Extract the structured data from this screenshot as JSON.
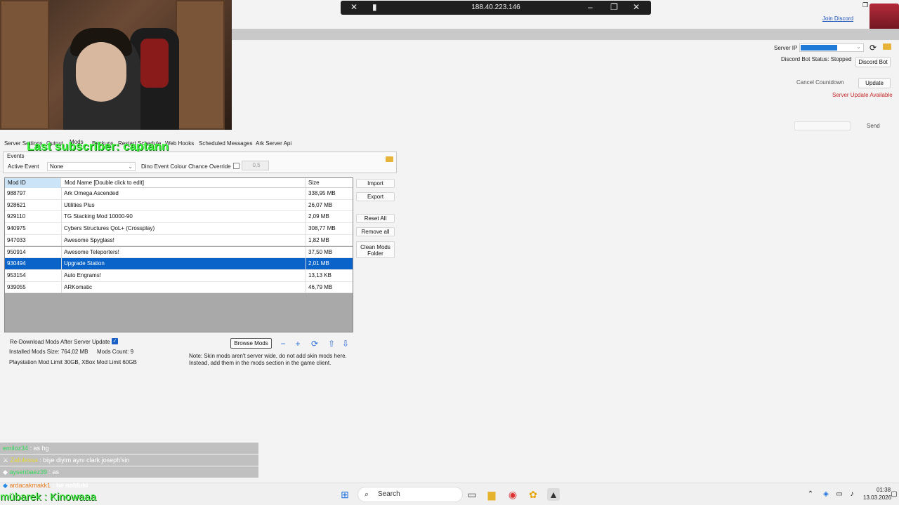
{
  "remote": {
    "ip": "188.40.223.146"
  },
  "header": {
    "join_discord": "Join Discord",
    "server_ip_label": "Server IP",
    "discord_status": "Discord Bot Status: Stopped",
    "discord_bot_button": "Discord Bot",
    "cancel_countdown": "Cancel Countdown",
    "update_button": "Update",
    "update_available": "Server Update Available",
    "send_button": "Send"
  },
  "overlay": {
    "subscriber": "Last subscriber: captann"
  },
  "tabs": [
    "Server Settings",
    "Output",
    "Mods",
    "Backups",
    "Restart Schedule",
    "Web Hooks",
    "Scheduled Messages",
    "Ark Server Api"
  ],
  "events": {
    "title": "Events",
    "active_event_label": "Active Event",
    "active_event_value": "None",
    "dino_label": "Dino Event Colour Chance Override",
    "dino_value": "0,5"
  },
  "table": {
    "headers": [
      "Mod ID",
      "Mod Name [Double click to edit]",
      "Size"
    ],
    "rows": [
      {
        "id": "988797",
        "name": "Ark Omega Ascended",
        "size": "338,95 MB"
      },
      {
        "id": "928621",
        "name": "Utilities Plus",
        "size": "26,07 MB"
      },
      {
        "id": "929110",
        "name": "TG Stacking Mod 10000-90",
        "size": "2,09 MB"
      },
      {
        "id": "940975",
        "name": "Cybers Structures QoL+ (Crossplay)",
        "size": "308,77 MB"
      },
      {
        "id": "947033",
        "name": "Awesome  Spyglass!",
        "size": "1,82 MB"
      },
      {
        "id": "950914",
        "name": "Awesome Teleporters!",
        "size": "37,50 MB"
      },
      {
        "id": "930494",
        "name": "Upgrade Station",
        "size": "2,01 MB"
      },
      {
        "id": "953154",
        "name": "Auto Engrams!",
        "size": "13,13 KB"
      },
      {
        "id": "939055",
        "name": "ARKomatic",
        "size": "46,79 MB"
      }
    ]
  },
  "side_buttons": {
    "import": "Import",
    "export": "Export",
    "reset_all": "Reset All",
    "remove_all": "Remove all",
    "clean_mods_1": "Clean Mods",
    "clean_mods_2": "Folder"
  },
  "bottom": {
    "redownload": "Re-Download Mods After Server Update",
    "installed_size": "Installed Mods Size: 764,02 MB",
    "mods_count": "Mods Count: 9",
    "limit": "Playstation Mod Limit 30GB, XBox Mod Limit 60GB",
    "browse_mods": "Browse Mods",
    "note_1": "Note: Skin mods aren't server wide, do not add skin mods here.",
    "note_2": "Instead, add them in the mods section in the game client."
  },
  "chat": [
    {
      "user": "emiloz34",
      "text": ": as hg"
    },
    {
      "user": "Zafulessa",
      "text": ": bişe diyim aynı clark joseph'sin"
    },
    {
      "user": "aysenbaez39",
      "text": ": as"
    },
    {
      "user": "ardacakmakk1",
      "text": ": he nolduki"
    }
  ],
  "ticker": "mübarek : Kinowaaa",
  "taskbar": {
    "search": "Search",
    "time": "01:38",
    "date": "13.03.2026"
  },
  "colors": {
    "selection": "#0a63c9",
    "accent": "#2a6fd6",
    "warning": "#c62828",
    "overlay_green": "#3ef63e"
  }
}
